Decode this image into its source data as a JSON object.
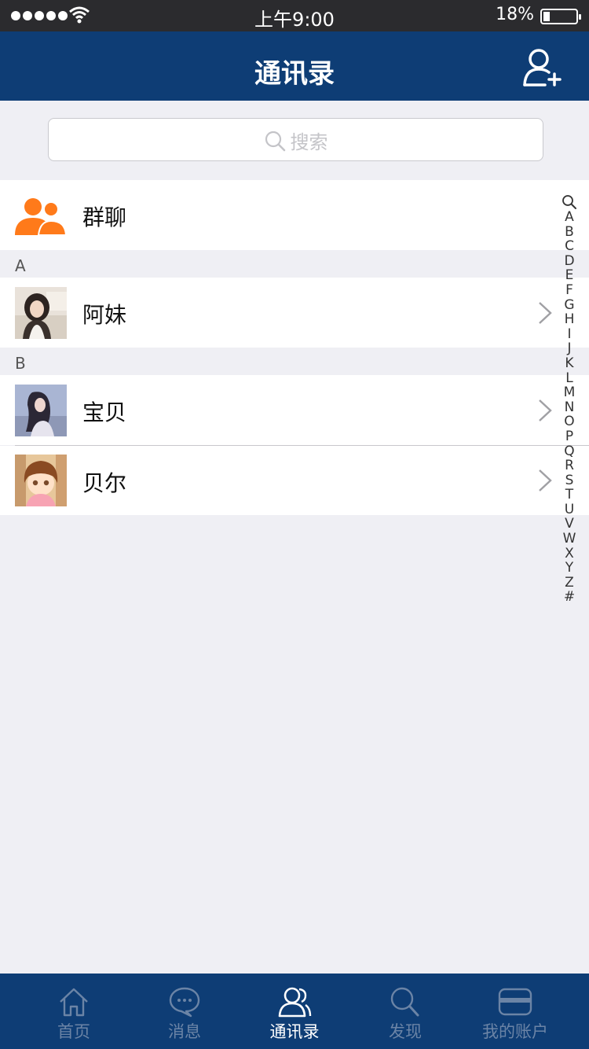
{
  "status_bar": {
    "time": "上午9:00",
    "battery": "18%"
  },
  "nav": {
    "title": "通讯录",
    "add_icon": "add-user-icon"
  },
  "search": {
    "placeholder": "搜索"
  },
  "group_chat": {
    "label": "群聊",
    "icon": "group-icon",
    "color": "#ff7a1a"
  },
  "sections": [
    {
      "header": "A",
      "contacts": [
        {
          "name": "阿妹"
        }
      ]
    },
    {
      "header": "B",
      "contacts": [
        {
          "name": "宝贝"
        },
        {
          "name": "贝尔"
        }
      ]
    }
  ],
  "index": [
    "A",
    "B",
    "C",
    "D",
    "E",
    "F",
    "G",
    "H",
    "I",
    "J",
    "K",
    "L",
    "M",
    "N",
    "O",
    "P",
    "Q",
    "R",
    "S",
    "T",
    "U",
    "V",
    "W",
    "X",
    "Y",
    "Z",
    "#"
  ],
  "tabs": [
    {
      "label": "首页",
      "icon": "home-icon"
    },
    {
      "label": "消息",
      "icon": "chat-bubble-icon"
    },
    {
      "label": "通讯录",
      "icon": "contacts-icon",
      "active": true
    },
    {
      "label": "发现",
      "icon": "search-icon"
    },
    {
      "label": "我的账户",
      "icon": "card-icon"
    }
  ],
  "colors": {
    "primary": "#0e3d75",
    "accent": "#ff7a1a",
    "background": "#efeff4"
  }
}
